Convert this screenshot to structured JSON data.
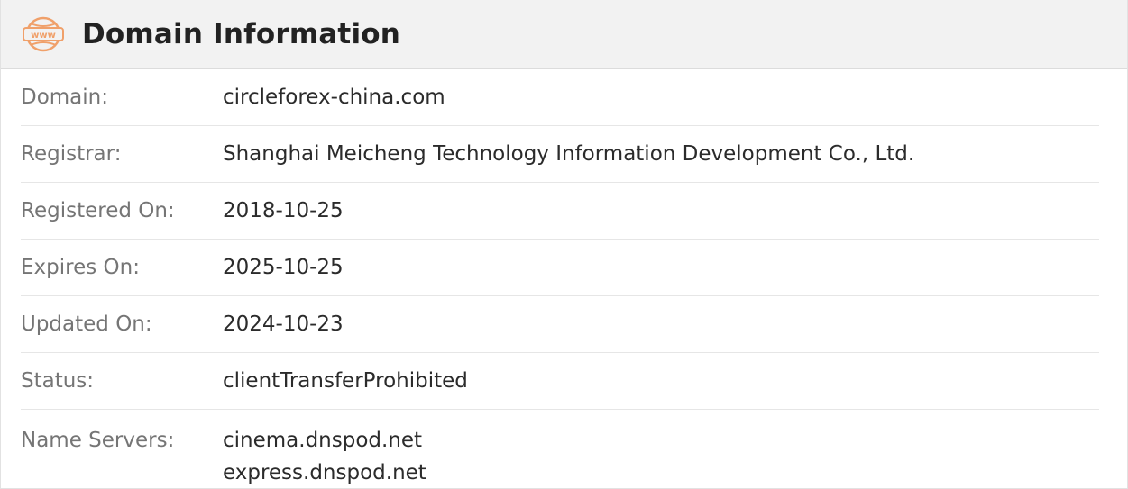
{
  "header": {
    "icon": "www-globe-icon",
    "icon_text": "www",
    "title": "Domain Information",
    "accent_color": "#f0a06a"
  },
  "rows": {
    "domain": {
      "label": "Domain:",
      "value": "circleforex-china.com"
    },
    "registrar": {
      "label": "Registrar:",
      "value": "Shanghai Meicheng Technology Information Development Co., Ltd."
    },
    "registered_on": {
      "label": "Registered On:",
      "value": "2018-10-25"
    },
    "expires_on": {
      "label": "Expires On:",
      "value": "2025-10-25"
    },
    "updated_on": {
      "label": "Updated On:",
      "value": "2024-10-23"
    },
    "status": {
      "label": "Status:",
      "value": "clientTransferProhibited"
    },
    "name_servers": {
      "label": "Name Servers:",
      "values": [
        "cinema.dnspod.net",
        "express.dnspod.net"
      ]
    }
  }
}
